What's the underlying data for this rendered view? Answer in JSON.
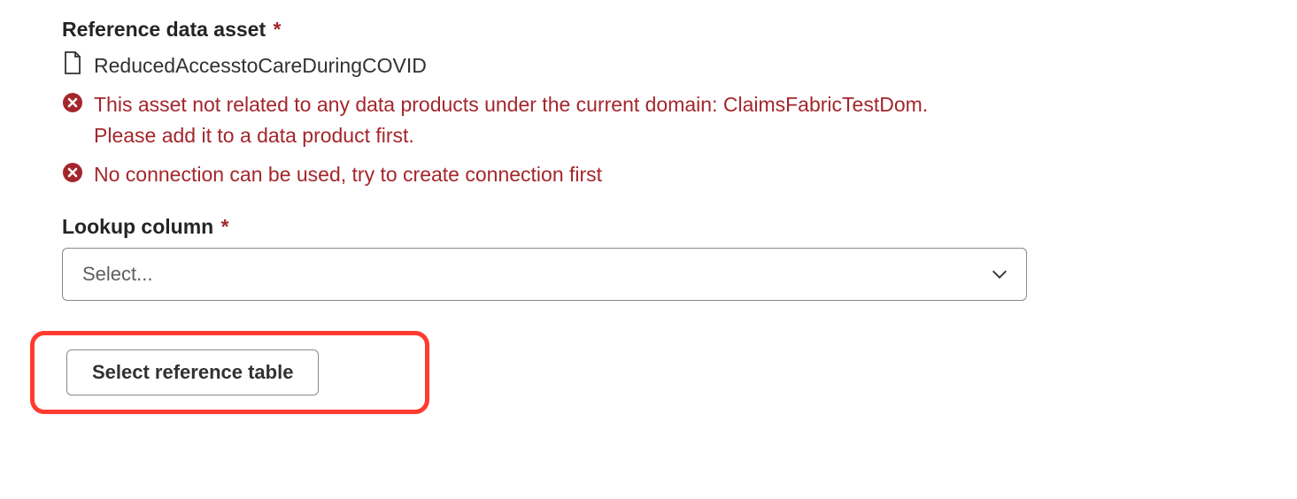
{
  "form": {
    "reference_data_asset": {
      "label": "Reference data asset",
      "required_mark": "*",
      "asset_name": "ReducedAccesstoCareDuringCOVID",
      "errors": [
        "This asset not related to any data products under the current domain: ClaimsFabricTestDom. Please add it to a data product first.",
        "No connection can be used, try to create connection first"
      ]
    },
    "lookup_column": {
      "label": "Lookup column",
      "required_mark": "*",
      "placeholder": "Select..."
    },
    "select_reference_table_button": "Select reference table"
  },
  "colors": {
    "error": "#a4262c",
    "text": "#323130",
    "border": "#8a8886",
    "highlight": "#ff3b30"
  }
}
